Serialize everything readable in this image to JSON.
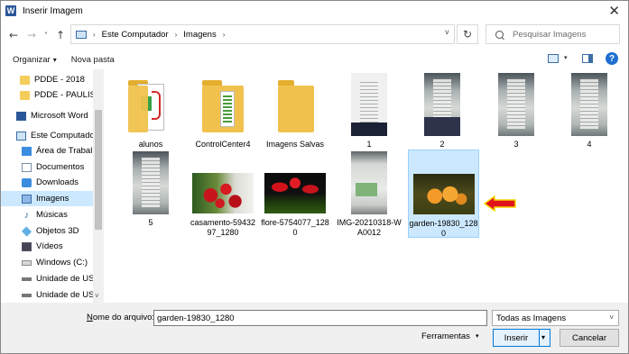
{
  "window": {
    "title": "Inserir Imagem",
    "close_glyph": "✕",
    "app_glyph": "W"
  },
  "nav": {
    "back_glyph": "←",
    "forward_glyph": "→",
    "recent_glyph": "˅",
    "up_glyph": "↑",
    "breadcrumb": [
      "Este Computador",
      "Imagens"
    ],
    "separator": "›",
    "dropdown_glyph": "˅",
    "refresh_glyph": "↻",
    "search_placeholder": "Pesquisar Imagens"
  },
  "toolbar": {
    "organize": "Organizar",
    "organize_arrow": "▾",
    "new_folder": "Nova pasta",
    "view_arrow": "▾",
    "help_glyph": "?"
  },
  "sidebar": {
    "items": [
      {
        "label": "PDDE - 2018",
        "icon": "folder-icon"
      },
      {
        "label": "PDDE - PAULISTA",
        "icon": "folder-icon"
      },
      {
        "label": "Microsoft Word",
        "icon": "word-icon"
      },
      {
        "label": "Este Computador",
        "icon": "computer-icon"
      },
      {
        "label": "Área de Trabalho",
        "icon": "desktop-icon"
      },
      {
        "label": "Documentos",
        "icon": "documents-icon"
      },
      {
        "label": "Downloads",
        "icon": "downloads-icon"
      },
      {
        "label": "Imagens",
        "icon": "pictures-icon"
      },
      {
        "label": "Músicas",
        "icon": "music-icon"
      },
      {
        "label": "Objetos 3D",
        "icon": "3d-objects-icon"
      },
      {
        "label": "Vídeos",
        "icon": "videos-icon"
      },
      {
        "label": "Windows (C:)",
        "icon": "drive-icon"
      },
      {
        "label": "Unidade de USB",
        "icon": "usb-drive-icon"
      },
      {
        "label": "Unidade de USB",
        "icon": "usb-drive-icon"
      }
    ],
    "music_glyph": "♪",
    "scroll_down_glyph": "˅"
  },
  "files": [
    {
      "name": "alunos",
      "kind": "folder-doc"
    },
    {
      "name": "ControlCenter4",
      "kind": "folder-doc2"
    },
    {
      "name": "Imagens Salvas",
      "kind": "folder"
    },
    {
      "name": "1",
      "kind": "doc-photo"
    },
    {
      "name": "2",
      "kind": "doc-photo"
    },
    {
      "name": "3",
      "kind": "doc-photo"
    },
    {
      "name": "4",
      "kind": "doc-photo"
    },
    {
      "name": "5",
      "kind": "doc-photo"
    },
    {
      "name": "casamento-5943297_1280",
      "kind": "roses"
    },
    {
      "name": "flore-5754077_1280",
      "kind": "tulips"
    },
    {
      "name": "IMG-20210318-WA0012",
      "kind": "screenshot"
    },
    {
      "name": "garden-19830_1280",
      "kind": "garden",
      "selected": true
    }
  ],
  "bottom": {
    "filename_label_underlined": "N",
    "filename_label_rest": "ome do arquivo:",
    "filename_value": "garden-19830_1280",
    "filter_value": "Todas as Imagens",
    "filter_arrow": "˅",
    "tools_label": "Ferramentas",
    "tools_arrow": "▾",
    "insert_label": "Inserir",
    "insert_arrow": "▾",
    "cancel_label": "Cancelar"
  },
  "colors": {
    "selection": "#cce8ff",
    "accent": "#0078d7",
    "arrow": "#e0131b"
  }
}
